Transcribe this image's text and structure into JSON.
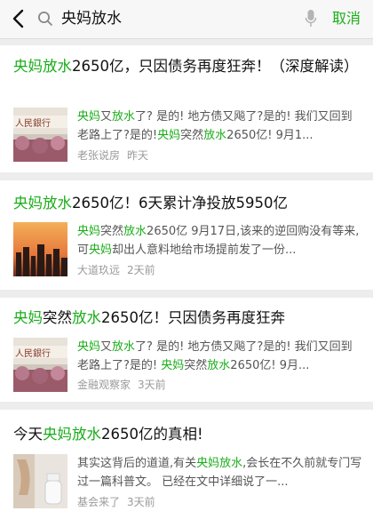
{
  "search": {
    "query": "央妈放水",
    "cancel_label": "取消"
  },
  "colors": {
    "highlight": "#1aad19",
    "meta": "#9a9a9a",
    "background": "#ededed"
  },
  "results": [
    {
      "title": [
        [
          "央妈放水",
          true
        ],
        [
          "2650亿，只因债务再度狂奔！（深度解读）",
          false
        ]
      ],
      "snippet": [
        [
          "央妈",
          true
        ],
        [
          "又",
          false
        ],
        [
          "放水",
          true
        ],
        [
          "了? 是的! 地方债又飚了?是的! 我们又回到老路上了?是的!",
          false
        ],
        [
          "央妈",
          true
        ],
        [
          "突然",
          false
        ],
        [
          "放水",
          true
        ],
        [
          "2650亿! 9月1...",
          false
        ]
      ],
      "source": "老张说房",
      "time": "昨天",
      "thumb_icon": "bank-building-thumbnail"
    },
    {
      "title": [
        [
          "央妈放水",
          true
        ],
        [
          "2650亿！6天累计净投放5950亿",
          false
        ]
      ],
      "snippet": [
        [
          "央妈",
          true
        ],
        [
          "突然",
          false
        ],
        [
          "放水",
          true
        ],
        [
          "2650亿 9月17日,该来的逆回购没有等来,可",
          false
        ],
        [
          "央妈",
          true
        ],
        [
          "却出人意料地给市场提前发了一份...",
          false
        ]
      ],
      "source": "大道玖远",
      "time": "2天前",
      "thumb_icon": "city-sunset-thumbnail"
    },
    {
      "title": [
        [
          "央妈",
          true
        ],
        [
          "突然",
          false
        ],
        [
          "放水",
          true
        ],
        [
          "2650亿！只因债务再度狂奔",
          false
        ]
      ],
      "snippet": [
        [
          "央妈",
          true
        ],
        [
          "又",
          false
        ],
        [
          "放水",
          true
        ],
        [
          "了? 是的! 地方债又飚了?是的! 我们又回到老路上了?是的! ",
          false
        ],
        [
          "央妈",
          true
        ],
        [
          "突然",
          false
        ],
        [
          "放水",
          true
        ],
        [
          "2650亿! 9月...",
          false
        ]
      ],
      "source": "金融观察家",
      "time": "3天前",
      "thumb_icon": "bank-building-thumbnail"
    },
    {
      "title": [
        [
          "今天",
          false
        ],
        [
          "央妈放水",
          true
        ],
        [
          "2650亿的真相!",
          false
        ]
      ],
      "snippet": [
        [
          "其实这背后的道道,有关",
          false
        ],
        [
          "央妈放水",
          true
        ],
        [
          ",会长在不久前就专门写过一篇科普文。 已经在文中详细说了一...",
          false
        ]
      ],
      "source": "基会来了",
      "time": "3天前",
      "thumb_icon": "bathroom-thumbnail"
    }
  ]
}
